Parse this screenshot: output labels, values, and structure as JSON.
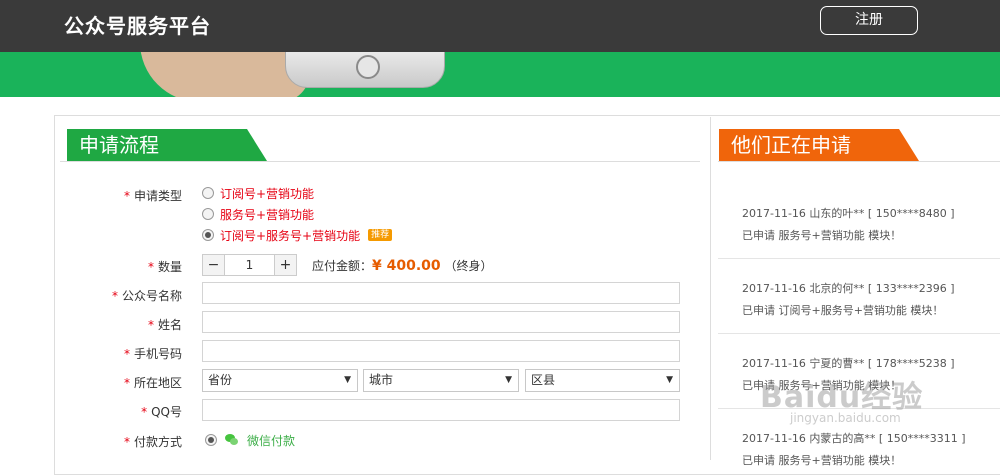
{
  "header": {
    "brand": "公众号服务平台",
    "register_label": "注册"
  },
  "apply": {
    "title": "申请流程",
    "type_label": "申请类型",
    "options": [
      {
        "label": "订阅号+营销功能",
        "checked": false
      },
      {
        "label": "服务号+营销功能",
        "checked": false
      },
      {
        "label": "订阅号+服务号+营销功能",
        "checked": true,
        "badge": "推荐"
      }
    ],
    "quantity_label": "数量",
    "quantity_minus": "−",
    "quantity_value": "1",
    "quantity_plus": "+",
    "amount_label": "应付金额：",
    "amount_value": "¥ 400.00",
    "amount_note": "（终身）",
    "account_name_label": "公众号名称",
    "name_label": "姓名",
    "phone_label": "手机号码",
    "region_label": "所在地区",
    "province_select": "省份",
    "city_select": "城市",
    "district_select": "区县",
    "qq_label": "QQ号",
    "payment_label": "付款方式",
    "payment_option": "微信付款",
    "required_mark": "*"
  },
  "applicants": {
    "title": "他们正在申请",
    "items": [
      {
        "line1": "2017-11-16  山东的叶**  [ 150****8480 ]",
        "line2": "已申请 服务号+营销功能 模块！"
      },
      {
        "line1": "2017-11-16  北京的何**  [ 133****2396 ]",
        "line2": "已申请 订阅号+服务号+营销功能 模块！"
      },
      {
        "line1": "2017-11-16  宁夏的曹**  [ 178****5238 ]",
        "line2": "已申请 服务号+营销功能 模块！"
      },
      {
        "line1": "2017-11-16  内蒙古的高**  [ 150****3311 ]",
        "line2": "已申请 服务号+营销功能 模块！"
      }
    ]
  },
  "watermark": {
    "main": "Baidu经验",
    "sub": "jingyan.baidu.com"
  },
  "colors": {
    "green": "#1fa843",
    "orange": "#f0650b",
    "header": "#3a3a3a",
    "required": "#e60012"
  },
  "icons": {
    "wechat": "wechat-icon",
    "select_arrow": "triangle-down-icon"
  }
}
